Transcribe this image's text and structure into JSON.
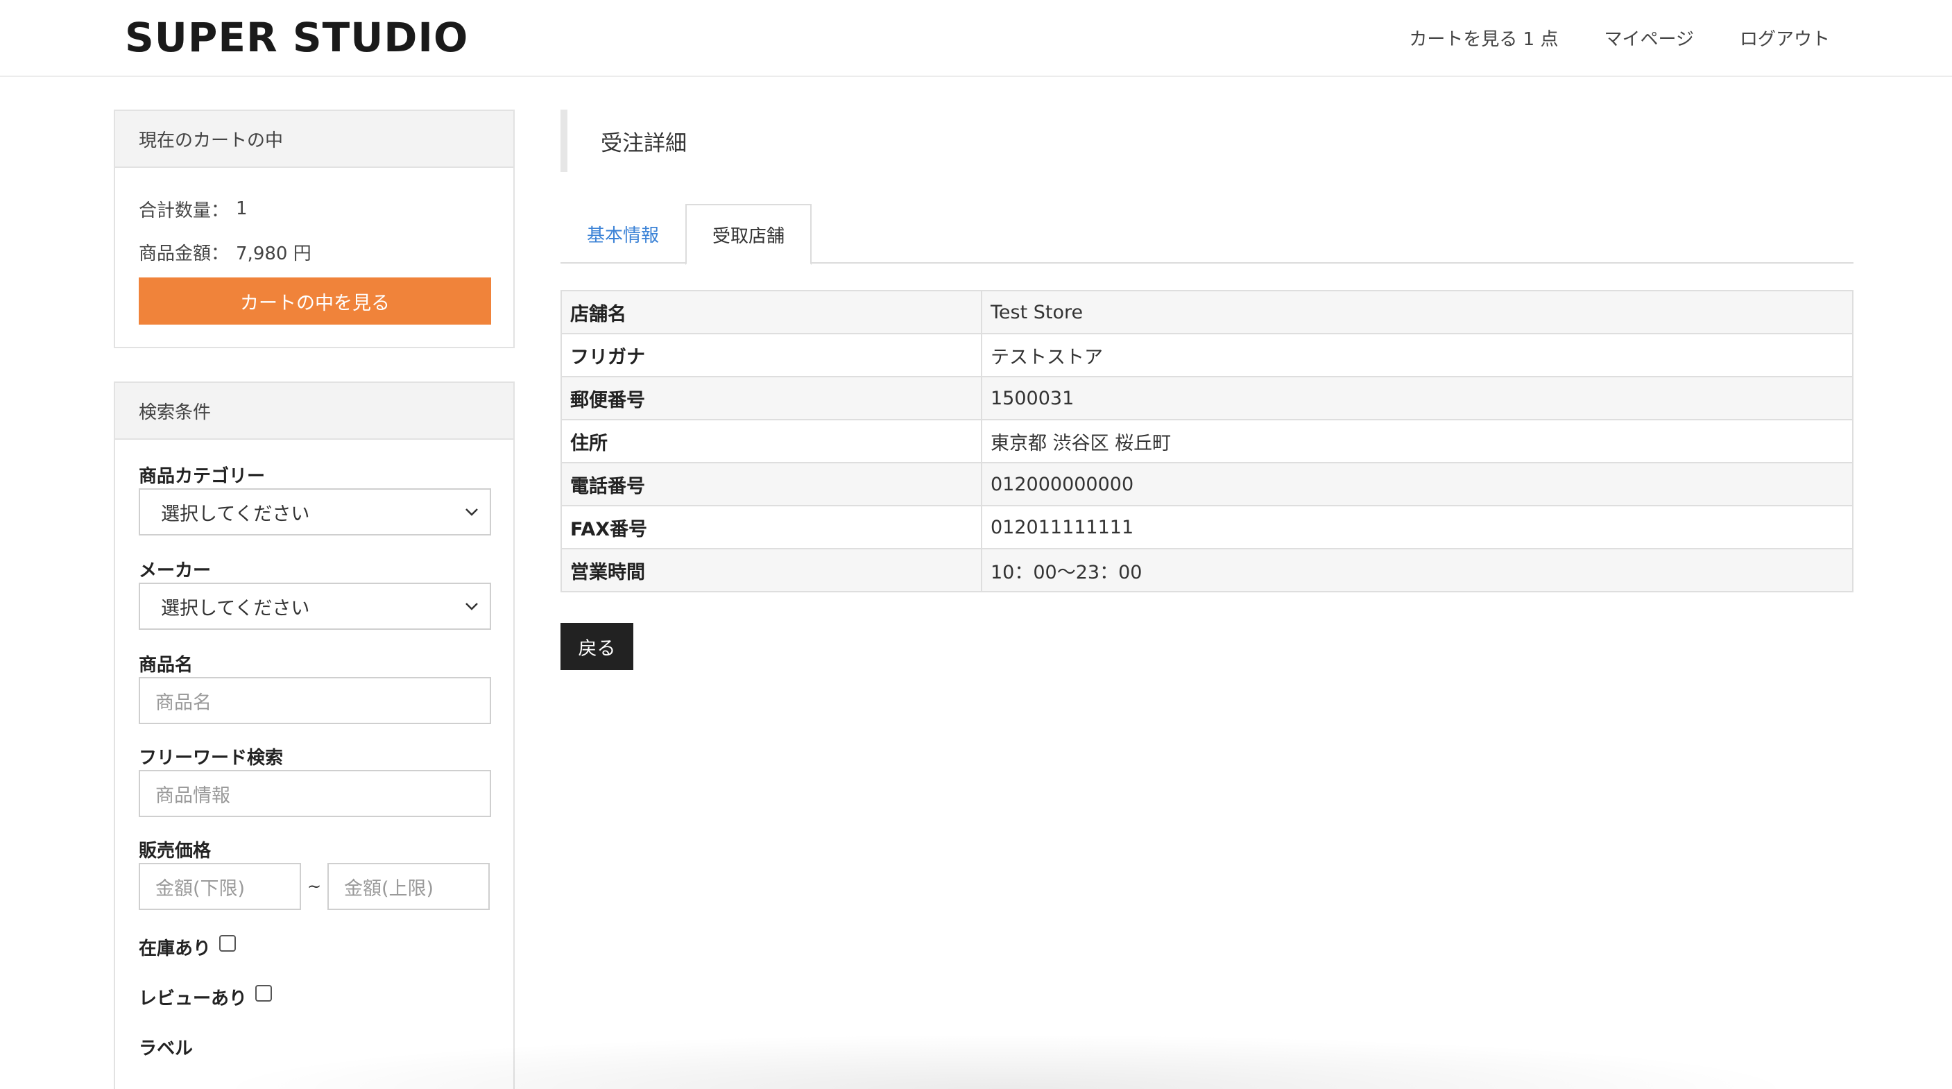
{
  "header": {
    "logo": "SUPER STUDIO",
    "nav": {
      "cart": "カートを見る 1 点",
      "mypage": "マイページ",
      "logout": "ログアウト"
    }
  },
  "cart_panel": {
    "title": "現在のカートの中",
    "quantity_label": "合計数量：",
    "quantity_value": "1",
    "amount_label": "商品金額：",
    "amount_value": "7,980 円",
    "view_button": "カートの中を見る"
  },
  "search_panel": {
    "title": "検索条件",
    "category_label": "商品カテゴリー",
    "category_value": "選択してください",
    "maker_label": "メーカー",
    "maker_value": "選択してください",
    "name_label": "商品名",
    "name_placeholder": "商品名",
    "freeword_label": "フリーワード検索",
    "freeword_placeholder": "商品情報",
    "price_label": "販売価格",
    "price_min_placeholder": "金額(下限)",
    "price_separator": "~",
    "price_max_placeholder": "金額(上限)",
    "stock_label": "在庫あり",
    "review_label": "レビューあり",
    "tag_label": "ラベル"
  },
  "main": {
    "title": "受注詳細",
    "tabs": [
      {
        "label": "基本情報",
        "active": false
      },
      {
        "label": "受取店舗",
        "active": true
      }
    ],
    "rows": [
      {
        "label": "店舗名",
        "value": "Test Store"
      },
      {
        "label": "フリガナ",
        "value": "テストストア"
      },
      {
        "label": "郵便番号",
        "value": "1500031"
      },
      {
        "label": "住所",
        "value": "東京都 渋谷区 桜丘町"
      },
      {
        "label": "電話番号",
        "value": "012000000000"
      },
      {
        "label": "FAX番号",
        "value": "012011111111"
      },
      {
        "label": "営業時間",
        "value": "10：00〜23：00"
      }
    ],
    "back_button": "戻る"
  },
  "colors": {
    "accent_orange": "#f0833a",
    "tab_link_blue": "#3b82d6",
    "dark_button": "#222222"
  },
  "icons": {
    "select_arrow": "chevron-down-icon"
  }
}
